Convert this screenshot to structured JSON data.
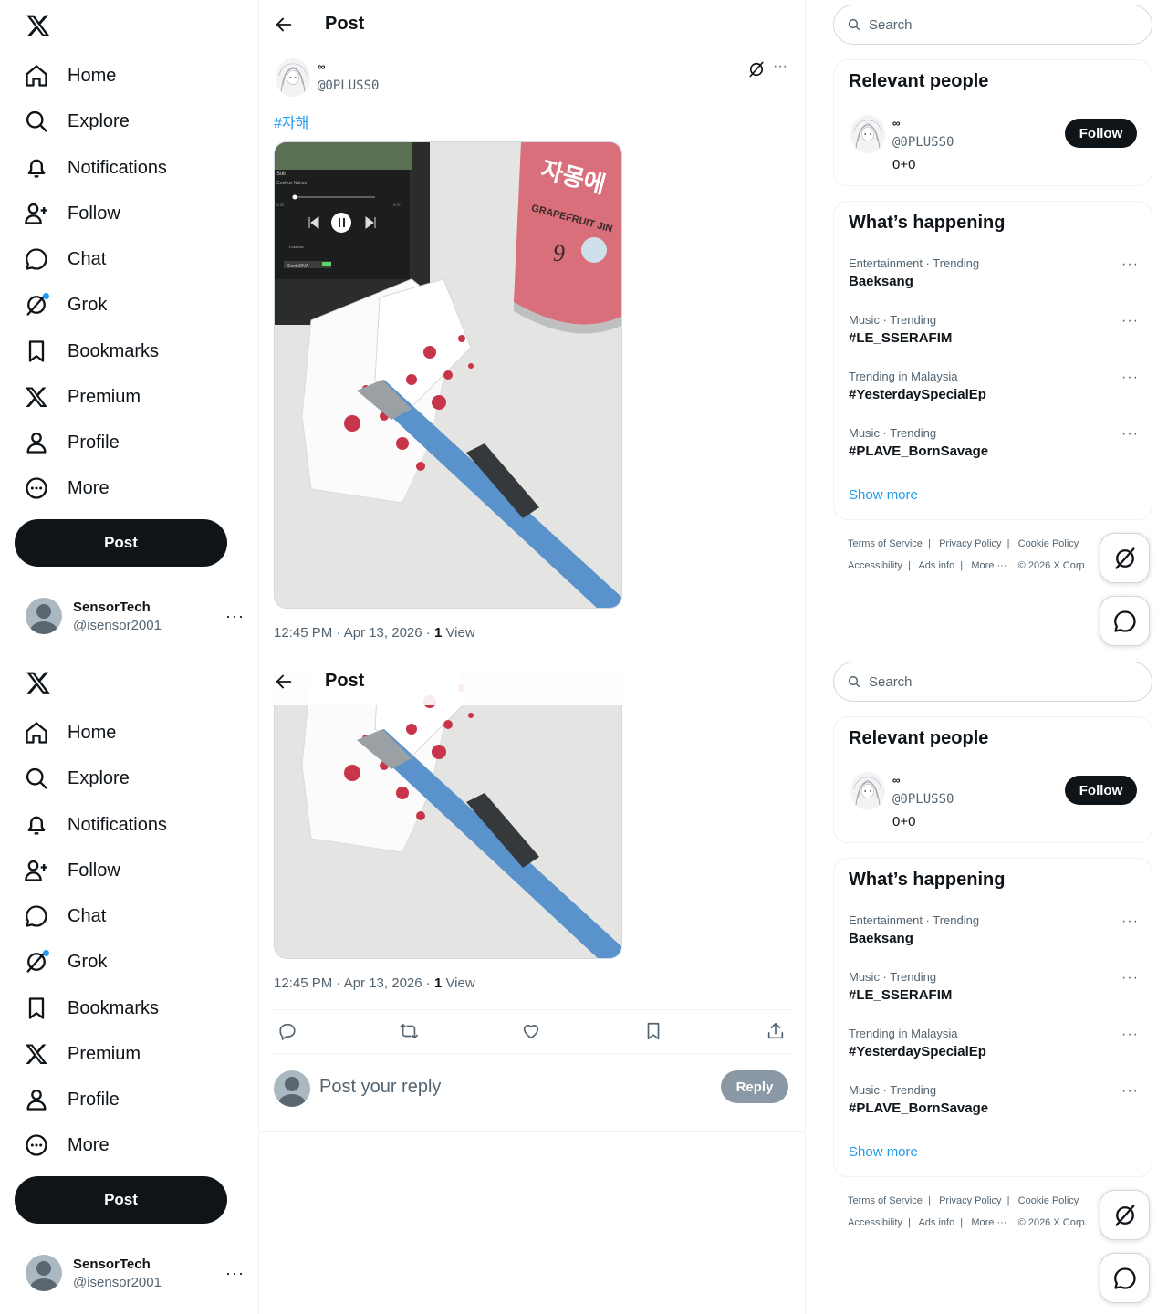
{
  "nav": {
    "items": [
      {
        "label": "Home",
        "icon": "home-icon"
      },
      {
        "label": "Explore",
        "icon": "search-icon"
      },
      {
        "label": "Notifications",
        "icon": "bell-icon"
      },
      {
        "label": "Follow",
        "icon": "person-add-icon"
      },
      {
        "label": "Chat",
        "icon": "chat-bubble-icon"
      },
      {
        "label": "Grok",
        "icon": "grok-icon"
      },
      {
        "label": "Bookmarks",
        "icon": "bookmark-icon"
      },
      {
        "label": "Premium",
        "icon": "x-logo-icon"
      },
      {
        "label": "Profile",
        "icon": "person-icon"
      },
      {
        "label": "More",
        "icon": "more-circle-icon"
      }
    ],
    "post_label": "Post"
  },
  "account": {
    "name": "SensorTech",
    "handle": "@isensor2001",
    "more": "···"
  },
  "header": {
    "title": "Post"
  },
  "post": {
    "author_name": "∞",
    "author_handle": "@0PLUSS0",
    "hashtag": "#자해",
    "time": "12:45 PM · Apr 13, 2026 · ",
    "views_count": "1",
    "views_label": " View",
    "more": "···",
    "phone_screen": {
      "track": "Still",
      "artist": "Goshun Nakao",
      "elapsed": "0:33",
      "duration": "3:37",
      "device": "Lossless",
      "app": "SonicDNA"
    },
    "can_text": {
      "brand": "자몽에",
      "flavor": "GRAPEFRUIT JIN",
      "number": "9"
    }
  },
  "reply": {
    "placeholder": "Post your reply",
    "button": "Reply"
  },
  "right": {
    "search_placeholder": "Search",
    "relevant_title": "Relevant people",
    "person": {
      "name": "∞",
      "handle": "@0PLUSS0",
      "bio": "0+0",
      "follow": "Follow"
    },
    "happening_title": "What’s happening",
    "trends": [
      {
        "category": "Entertainment · Trending",
        "title": "Baeksang"
      },
      {
        "category": "Music · Trending",
        "title": "#LE_SSERAFIM"
      },
      {
        "category": "Trending in Malaysia",
        "title": "#YesterdaySpecialEp"
      },
      {
        "category": "Music · Trending",
        "title": "#PLAVE_BornSavage"
      }
    ],
    "trend_more": "···",
    "show_more": "Show more",
    "footer": {
      "tos": "Terms of Service",
      "privacy": "Privacy Policy",
      "cookie": "Cookie Policy",
      "accessibility": "Accessibility",
      "ads": "Ads info",
      "more": "More ···",
      "copyright": "© 2026 X Corp."
    }
  },
  "colors": {
    "accent": "#1d9bf0",
    "text": "#0f1419",
    "muted": "#536471",
    "border": "#eff3f4",
    "button_dark": "#0f1419",
    "reply_disabled": "#8b98a5"
  }
}
